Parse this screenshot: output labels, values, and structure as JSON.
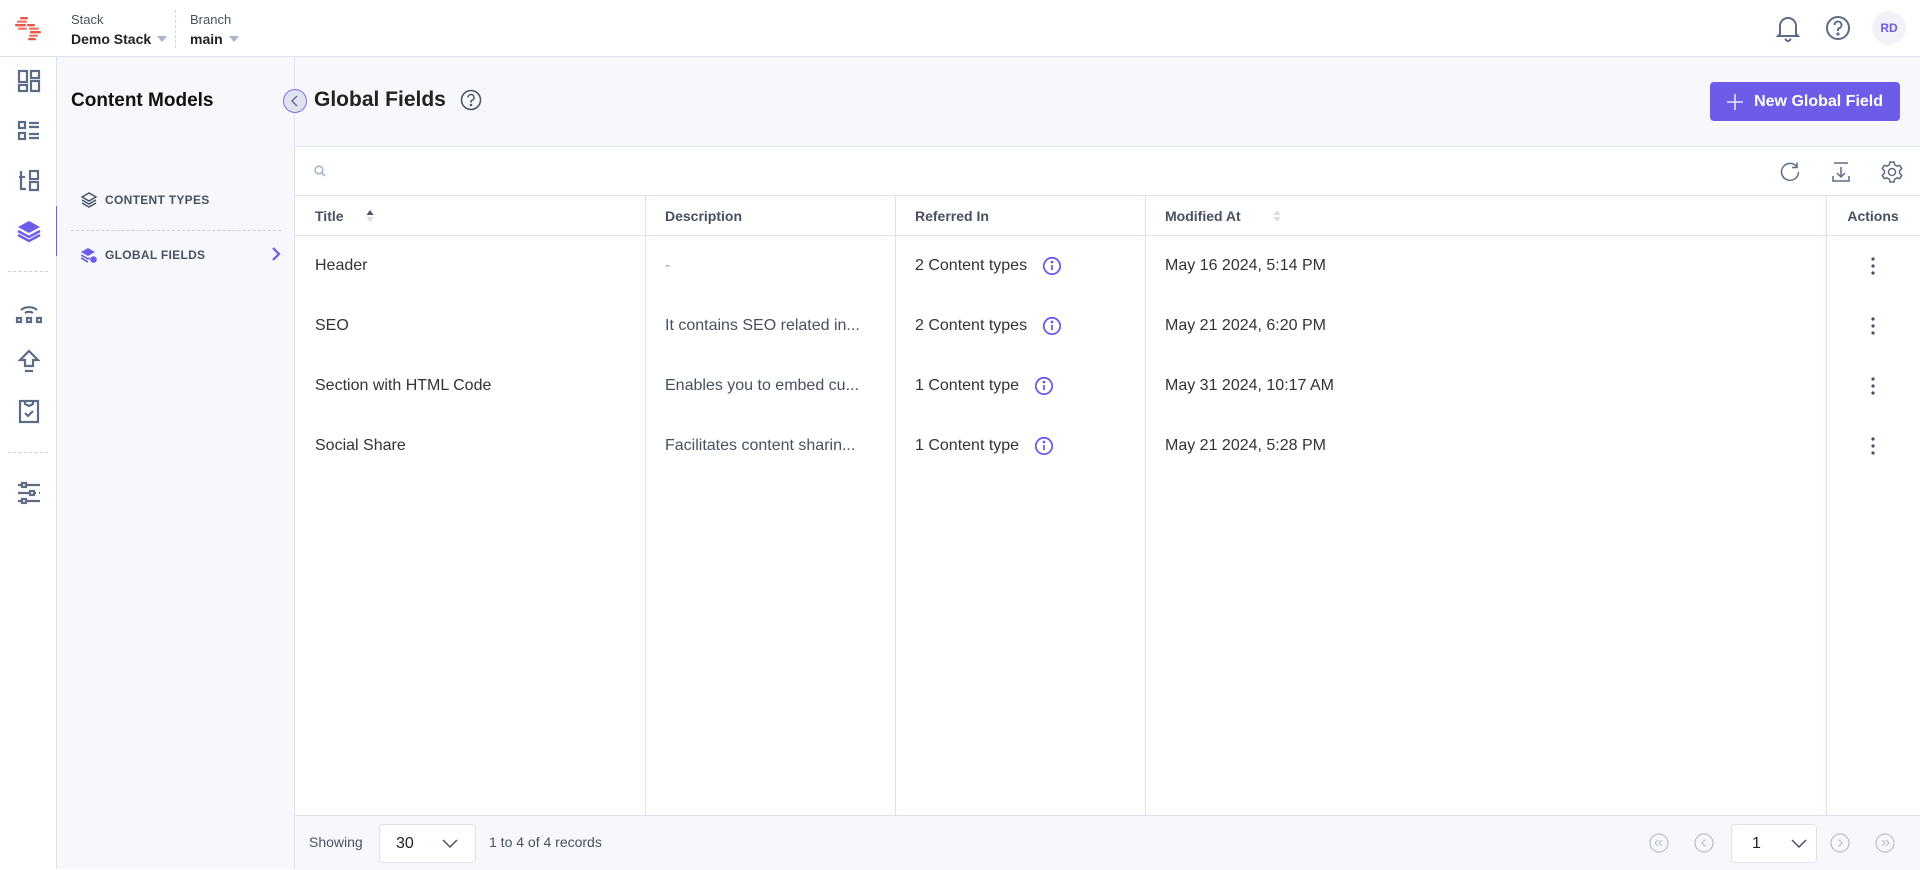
{
  "topbar": {
    "stack_label": "Stack",
    "stack_value": "Demo Stack",
    "branch_label": "Branch",
    "branch_value": "main",
    "avatar_initials": "RD",
    "icons": [
      "bell-icon",
      "help-icon"
    ]
  },
  "rail": {
    "items": [
      "dashboard-icon",
      "entries-icon",
      "assets-icon",
      "content-models-icon",
      "releases-icon",
      "publish-queue-icon",
      "tasks-icon",
      "settings-icon"
    ],
    "active": "content-models-icon"
  },
  "sidebar": {
    "title": "Content Models",
    "items": [
      {
        "label": "CONTENT TYPES",
        "icon": "layers-icon",
        "active": false
      },
      {
        "label": "GLOBAL FIELDS",
        "icon": "global-fields-icon",
        "active": true
      }
    ]
  },
  "page": {
    "title": "Global Fields",
    "new_button": "New Global Field",
    "search_placeholder": ""
  },
  "colors": {
    "accent": "#6c5ce7",
    "border": "#dde3ee",
    "bg_light": "#f7f8fc"
  },
  "table": {
    "columns": [
      {
        "label": "Title",
        "sort": "asc"
      },
      {
        "label": "Description"
      },
      {
        "label": "Referred In"
      },
      {
        "label": "Modified At",
        "sort": "none"
      },
      {
        "label": "Actions"
      }
    ],
    "rows": [
      {
        "title": "Header",
        "description": "-",
        "referred_in": "2 Content types",
        "modified_at": "May 16 2024, 5:14 PM"
      },
      {
        "title": "SEO",
        "description": "It contains SEO related in...",
        "referred_in": "2 Content types",
        "modified_at": "May 21 2024, 6:20 PM"
      },
      {
        "title": "Section with HTML Code",
        "description": "Enables you to embed cu...",
        "referred_in": "1 Content type",
        "modified_at": "May 31 2024, 10:17 AM"
      },
      {
        "title": "Social Share",
        "description": "Facilitates content sharin...",
        "referred_in": "1 Content type",
        "modified_at": "May 21 2024, 5:28 PM"
      }
    ]
  },
  "footer": {
    "showing_label": "Showing",
    "per_page": "30",
    "records_text": "1 to 4 of 4 records",
    "current_page": "1"
  }
}
